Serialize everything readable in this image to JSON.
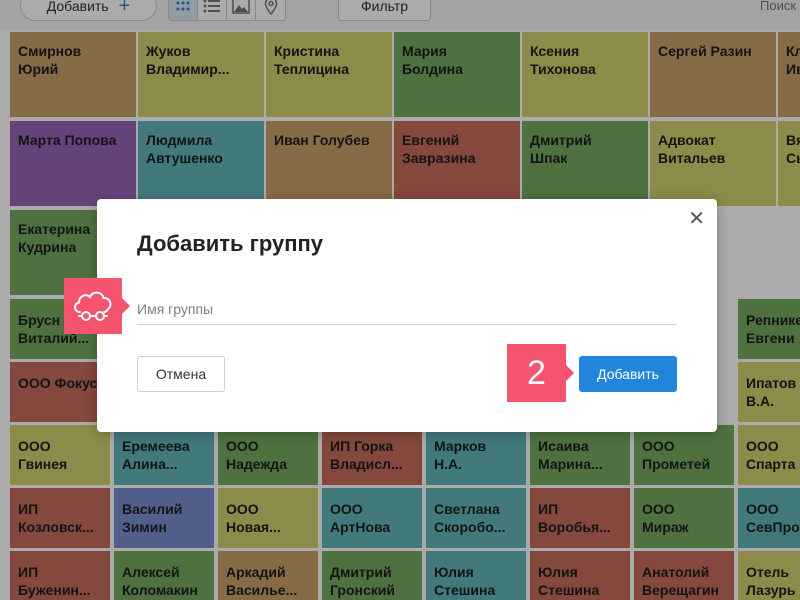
{
  "toolbar": {
    "add_label": "Добавить",
    "add_icon": "plus-icon",
    "filter_label": "Фильтр",
    "search_placeholder": "Поиск",
    "views": [
      "grid-view",
      "list-view",
      "image-view",
      "map-view"
    ],
    "active_view": "grid-view"
  },
  "colors": {
    "tan": "#c9a06a",
    "yellow": "#d2cf6d",
    "green": "#77a95f",
    "purple": "#9566b8",
    "teal": "#63b5b8",
    "red": "#c56c5c",
    "blue": "#7b8ed0",
    "accent": "#2384db",
    "hint": "#f4546e"
  },
  "contacts": [
    {
      "name": "Смирнов\nЮрий",
      "color": "tan"
    },
    {
      "name": "Жуков\nВладимир...",
      "color": "yellow"
    },
    {
      "name": "Кристина\nТеплицина",
      "color": "yellow"
    },
    {
      "name": "Мария\nБолдина",
      "color": "green"
    },
    {
      "name": "Ксения\nТихонова",
      "color": "yellow"
    },
    {
      "name": "Сергей Разин",
      "color": "tan"
    },
    {
      "name": "Кл\nИв",
      "color": "tan"
    },
    {
      "name": "Марта Попова",
      "color": "purple"
    },
    {
      "name": "Людмила\nАвтушенко",
      "color": "teal"
    },
    {
      "name": "Иван Голубев",
      "color": "tan"
    },
    {
      "name": "Евгений\nЗавразина",
      "color": "red"
    },
    {
      "name": "Дмитрий\nШпак",
      "color": "green"
    },
    {
      "name": "Адвокат\nВитальев",
      "color": "yellow"
    },
    {
      "name": "Вя\nСы",
      "color": "yellow"
    },
    {
      "name": "Екатерина\nКудрина",
      "color": "green"
    },
    {
      "name": "Брусн\nВиталий...",
      "color": "green"
    },
    {
      "name": "Репнике\nЕвгени",
      "color": "green"
    },
    {
      "name": "ООО Фокус",
      "color": "red"
    },
    {
      "name": "Ипатов\nВ.А.",
      "color": "yellow"
    },
    {
      "name": "ООО\nГвинея",
      "color": "yellow"
    },
    {
      "name": "Еремеева\nАлина...",
      "color": "teal"
    },
    {
      "name": "ООО\nНадежда",
      "color": "green"
    },
    {
      "name": "ИП Горка\nВладисл...",
      "color": "red"
    },
    {
      "name": "Марков\nН.А.",
      "color": "teal"
    },
    {
      "name": "Исаива\nМарина...",
      "color": "green"
    },
    {
      "name": "ООО\nПрометей",
      "color": "green"
    },
    {
      "name": "ООО\nСпарта",
      "color": "yellow"
    },
    {
      "name": "ИП\nКозловск...",
      "color": "red"
    },
    {
      "name": "Василий\nЗимин",
      "color": "blue"
    },
    {
      "name": "ООО\nНовая...",
      "color": "yellow"
    },
    {
      "name": "ООО\nАртНова",
      "color": "teal"
    },
    {
      "name": "Светлана\nСкоробо...",
      "color": "teal"
    },
    {
      "name": "ИП\nВоробья...",
      "color": "red"
    },
    {
      "name": "ООО\nМираж",
      "color": "green"
    },
    {
      "name": "ООО\nСевПро",
      "color": "teal"
    },
    {
      "name": "ИП\nБуженин...",
      "color": "red"
    },
    {
      "name": "Алексей\nКоломакин",
      "color": "green"
    },
    {
      "name": "Аркадий\nВасилье...",
      "color": "tan"
    },
    {
      "name": "Дмитрий\nГронский",
      "color": "green"
    },
    {
      "name": "Юлия\nСтешина",
      "color": "teal"
    },
    {
      "name": "Юлия\nСтешина",
      "color": "red"
    },
    {
      "name": "Анатолий\nВерещагин",
      "color": "red"
    },
    {
      "name": "Отель\nЛазурь",
      "color": "yellow"
    }
  ],
  "modal": {
    "title": "Добавить группу",
    "input_placeholder": "Имя группы",
    "cancel_label": "Отмена",
    "submit_label": "Добавить",
    "close_icon": "close-icon"
  },
  "hints": {
    "field_icon": "cloud-car-icon",
    "step_number": "2"
  }
}
